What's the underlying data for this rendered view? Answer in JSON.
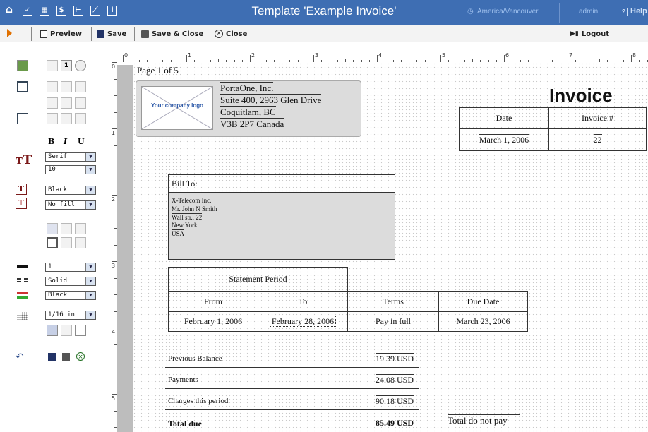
{
  "topbar": {
    "title": "Template 'Example Invoice'",
    "timezone": "America/Vancouver",
    "user": "admin",
    "help": "Help"
  },
  "toolbar": {
    "preview": "Preview",
    "save": "Save",
    "save_close": "Save & Close",
    "close": "Close",
    "logout": "Logout"
  },
  "panel": {
    "bold": "B",
    "italic": "I",
    "underline": "U",
    "font_family": "Serif",
    "font_size": "10",
    "text_color": "Black",
    "fill_color": "No fill",
    "border_width": "1",
    "border_style": "Solid",
    "border_color": "Black",
    "grid_step": "1/16 in"
  },
  "ruler": {
    "marks": [
      "0",
      "1",
      "2",
      "3",
      "4",
      "5",
      "6",
      "7",
      "8"
    ],
    "vmarks": [
      "0",
      "1",
      "2",
      "3",
      "4",
      "5"
    ]
  },
  "page": {
    "page_indicator": "Page 1 of 5",
    "logo_text": "Your company logo",
    "company_lines": [
      "PortaOne, Inc.",
      "Suite 400, 2963 Glen Drive",
      "Coquitlam, BC",
      "V3B 2P7 Canada"
    ],
    "invoice_title": "Invoice",
    "date_header": "Date",
    "invoice_no_header": "Invoice #",
    "date_value": "March 1, 2006",
    "invoice_no_value": "22",
    "bill_to_label": "Bill To:",
    "bill_to_lines": [
      "X-Telecom Inc.",
      "Mr. John N Smith",
      "Wall str., 22",
      "New York",
      "USA"
    ],
    "statement_period": "Statement Period",
    "from_header": "From",
    "to_header": "To",
    "terms_header": "Terms",
    "due_header": "Due Date",
    "from_value": "February 1, 2006",
    "to_value": "February 28, 2006",
    "terms_value": "Pay in full",
    "due_value": "March 23, 2006",
    "prev_balance_label": "Previous Balance",
    "prev_balance_value": "19.39 USD",
    "payments_label": "Payments",
    "payments_value": "24.08 USD",
    "charges_label": "Charges this period",
    "charges_value": "90.18 USD",
    "total_label": "Total due",
    "total_value": "85.49 USD",
    "total_note": "Total do not pay"
  },
  "colors": {
    "topbar": "#3e6eb3",
    "toolbar": "#f3f3f3",
    "logo_box": "#dcdcdc",
    "bill_box": "#dcdcdc"
  }
}
